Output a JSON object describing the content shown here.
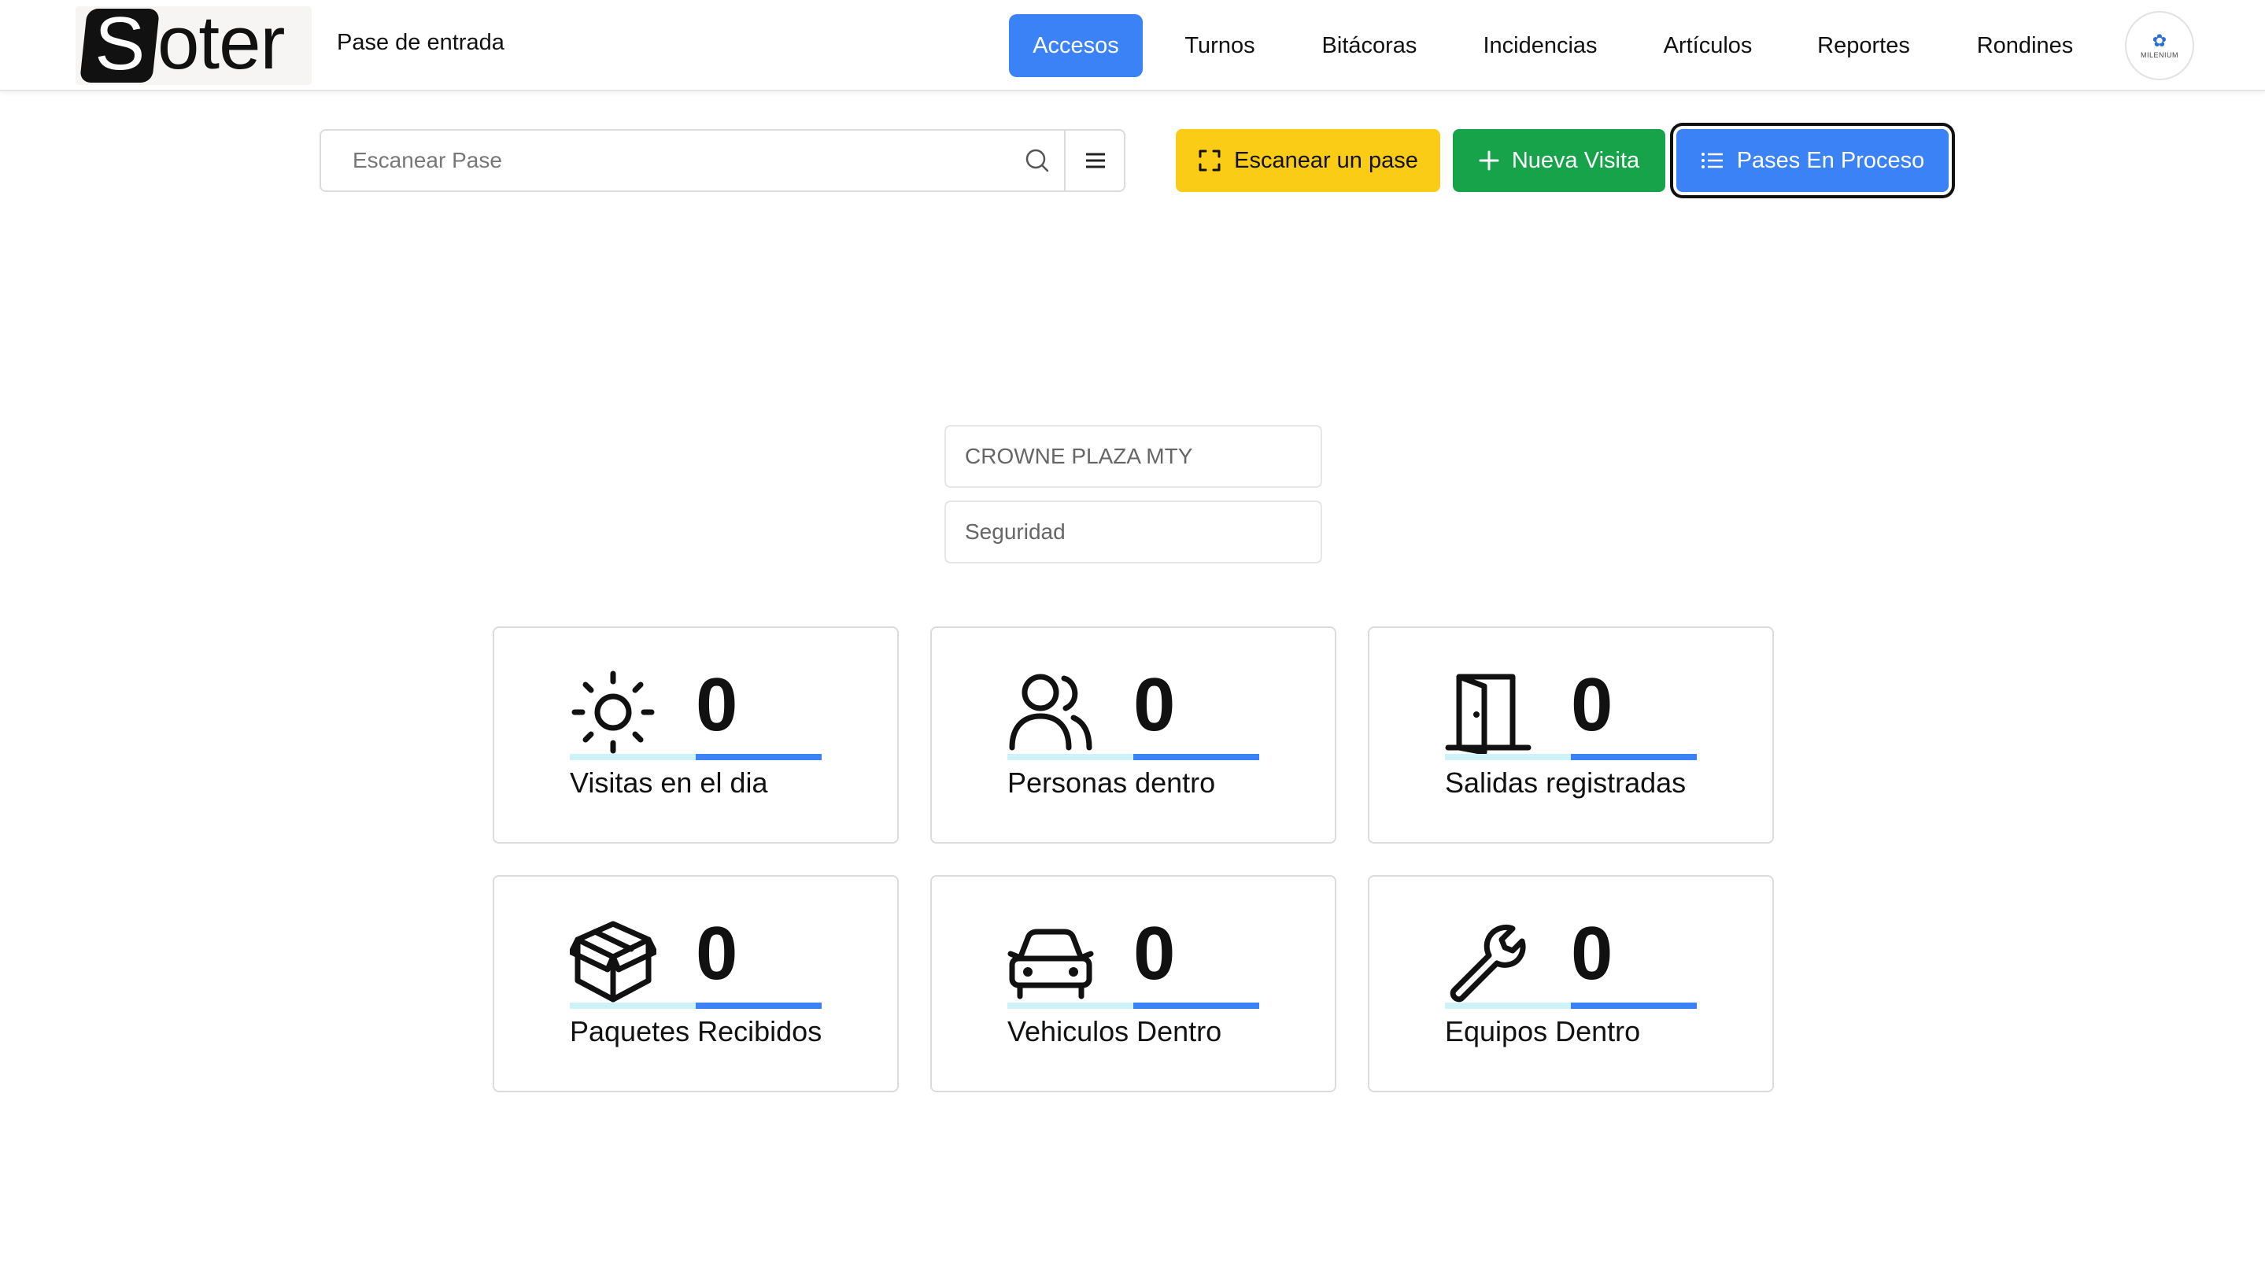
{
  "header": {
    "logo_letter": "S",
    "logo_rest": "oter",
    "page_title": "Pase de entrada",
    "nav": [
      {
        "label": "Accesos",
        "active": true
      },
      {
        "label": "Turnos",
        "active": false
      },
      {
        "label": "Bitácoras",
        "active": false
      },
      {
        "label": "Incidencias",
        "active": false
      },
      {
        "label": "Artículos",
        "active": false
      },
      {
        "label": "Reportes",
        "active": false
      },
      {
        "label": "Rondines",
        "active": false
      }
    ],
    "avatar_text": "MILENIUM"
  },
  "toolbar": {
    "search_placeholder": "Escanear Pase",
    "scan_button": "Escanear un pase",
    "new_visit_button": "Nueva Visita",
    "passes_button": "Pases En Proceso"
  },
  "info": {
    "location": "CROWNE PLAZA MTY",
    "area": "Seguridad"
  },
  "stats": [
    {
      "icon": "sun-icon",
      "value": "0",
      "label": "Visitas en el dia"
    },
    {
      "icon": "users-icon",
      "value": "0",
      "label": "Personas dentro"
    },
    {
      "icon": "door-exit-icon",
      "value": "0",
      "label": "Salidas registradas"
    },
    {
      "icon": "package-icon",
      "value": "0",
      "label": "Paquetes Recibidos"
    },
    {
      "icon": "car-icon",
      "value": "0",
      "label": "Vehiculos Dentro"
    },
    {
      "icon": "wrench-icon",
      "value": "0",
      "label": "Equipos Dentro"
    }
  ],
  "colors": {
    "accent_blue": "#3b82f6",
    "scan_yellow": "#facc15",
    "visit_green": "#16a34a",
    "bar_light": "#cdf3f8"
  }
}
